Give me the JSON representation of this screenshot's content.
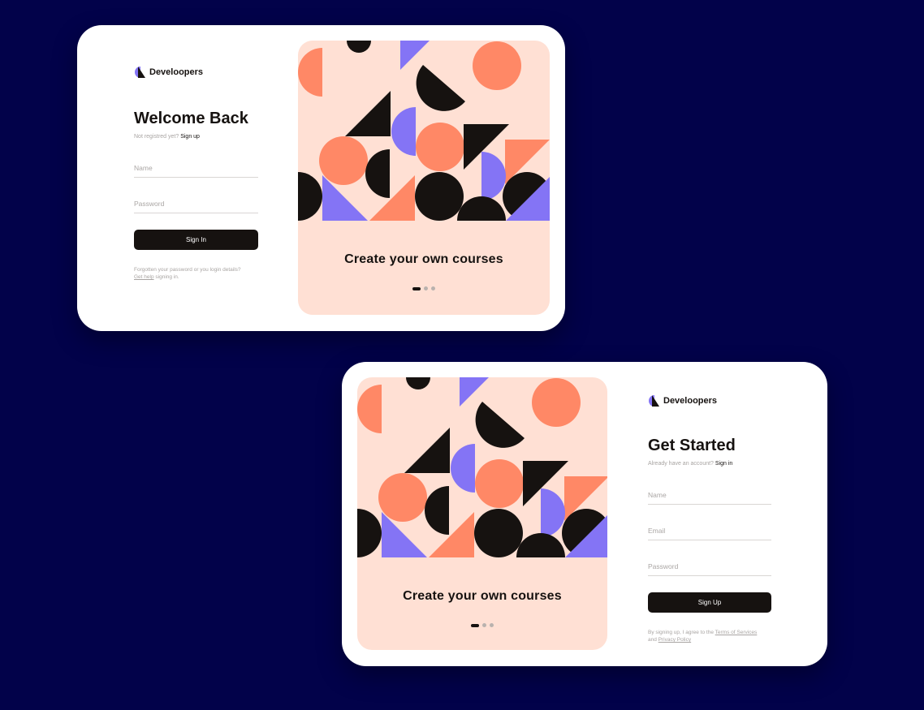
{
  "brand": {
    "name": "Develoopers",
    "logo_icon": "half-circle-triangle-logo-icon",
    "colors": {
      "purple": "#8474f5",
      "black": "#161210",
      "coral": "#ff8866"
    }
  },
  "colors": {
    "background": "#02024a",
    "panel": "#ffe0d4",
    "black": "#161210",
    "coral": "#ff8866",
    "purple": "#8474f5"
  },
  "signin": {
    "title": "Welcome Back",
    "subtitle_prefix": "Not registred yet?",
    "subtitle_link": "Sign up",
    "fields": {
      "name_placeholder": "Name",
      "password_placeholder": "Password"
    },
    "submit_label": "Sign In",
    "help_prefix": "Forgotten your password or you login details?",
    "help_link": "Get help",
    "help_suffix": "signing in.",
    "panel": {
      "caption": "Create your own courses",
      "active_dot": 1,
      "dot_count": 3
    }
  },
  "signup": {
    "title": "Get Started",
    "subtitle_prefix": "Already have an account?",
    "subtitle_link": "Sign in",
    "fields": {
      "name_placeholder": "Name",
      "email_placeholder": "Email",
      "password_placeholder": "Password"
    },
    "submit_label": "Sign Up",
    "terms_prefix": "By signing up, I agree to the",
    "terms_link": "Terms of Services",
    "terms_and": "and",
    "privacy_link": "Privacy Policy",
    "panel": {
      "caption": "Create your own courses",
      "active_dot": 1,
      "dot_count": 3
    }
  }
}
